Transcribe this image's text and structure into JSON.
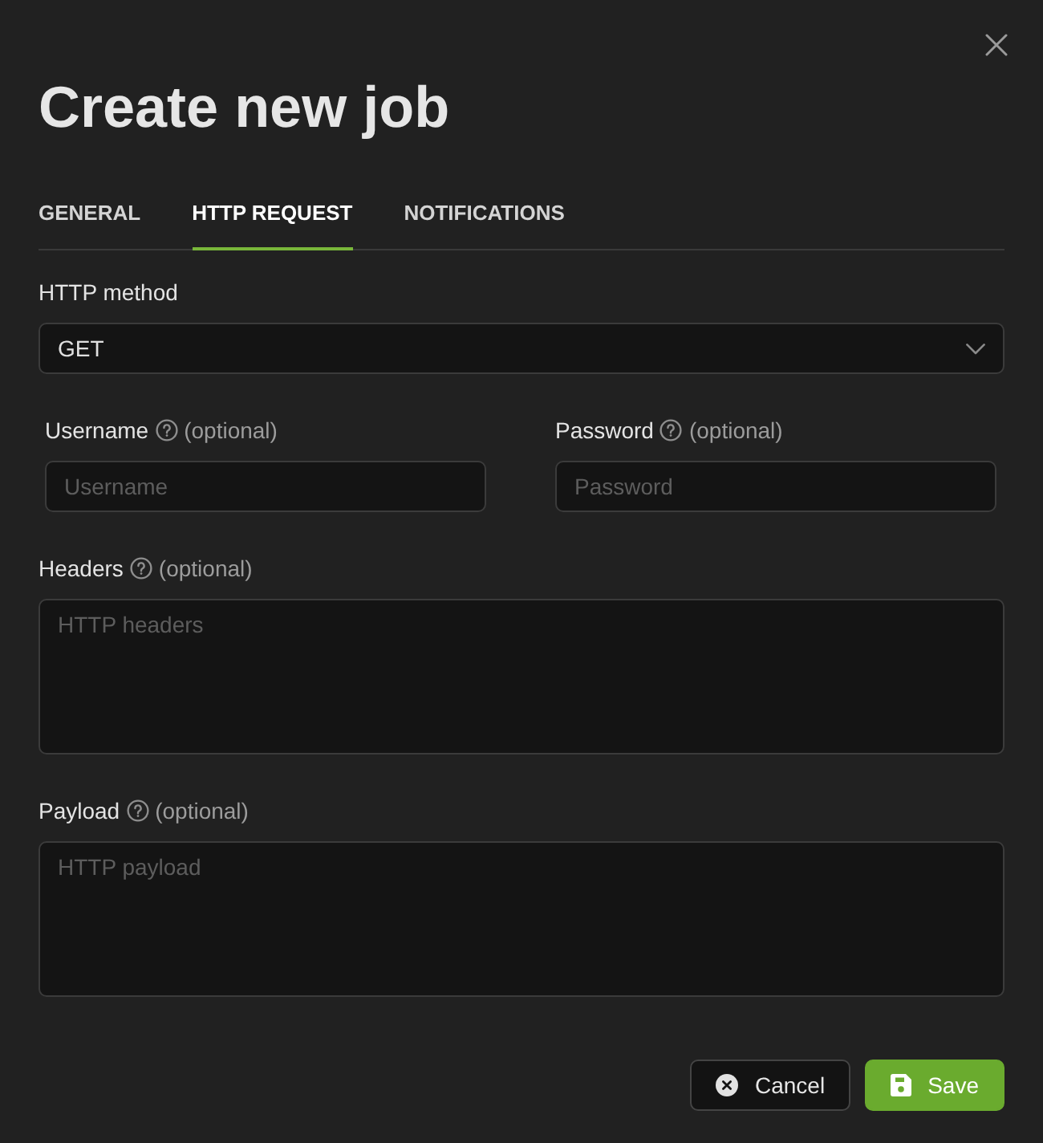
{
  "dialog": {
    "title": "Create new job"
  },
  "tabs": [
    {
      "label": "GENERAL",
      "selected": false
    },
    {
      "label": "HTTP REQUEST",
      "selected": true
    },
    {
      "label": "NOTIFICATIONS",
      "selected": false
    }
  ],
  "method": {
    "label": "HTTP method",
    "value": "GET"
  },
  "credentials": [
    {
      "label": "Username",
      "help": true,
      "hint": "(optional)",
      "placeholder": "Username"
    },
    {
      "label": "Password",
      "help": true,
      "hint": "(optional)",
      "placeholder": "Password"
    }
  ],
  "text_areas": [
    {
      "label": "Headers",
      "help": true,
      "hint": "(optional)",
      "placeholder": "HTTP headers"
    },
    {
      "label": "Payload",
      "help": true,
      "hint": "(optional)",
      "placeholder": "HTTP payload"
    }
  ],
  "buttons": [
    {
      "label": "Cancel",
      "kind": "cancel"
    },
    {
      "label": "Save",
      "kind": "save"
    }
  ]
}
